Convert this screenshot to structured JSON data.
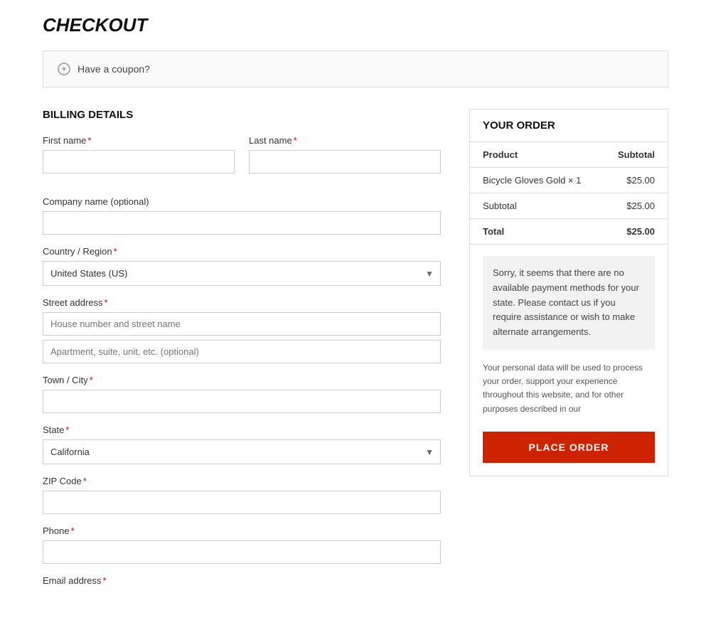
{
  "page": {
    "title": "CHECKOUT"
  },
  "coupon": {
    "text": "Have a coupon?",
    "icon": "tag"
  },
  "billing": {
    "section_title": "BILLING DETAILS",
    "fields": {
      "first_name_label": "First name",
      "last_name_label": "Last name",
      "company_label": "Company name (optional)",
      "country_label": "Country / Region",
      "country_value": "United States (US)",
      "street_label": "Street address",
      "street_placeholder": "House number and street name",
      "apt_placeholder": "Apartment, suite, unit, etc. (optional)",
      "city_label": "Town / City",
      "state_label": "State",
      "state_value": "California",
      "zip_label": "ZIP Code",
      "phone_label": "Phone",
      "email_label": "Email address"
    }
  },
  "order": {
    "section_title": "YOUR ORDER",
    "col_product": "Product",
    "col_subtotal": "Subtotal",
    "items": [
      {
        "name": "Bicycle Gloves Gold",
        "qty": "× 1",
        "price": "$25.00"
      }
    ],
    "subtotal_label": "Subtotal",
    "subtotal_value": "$25.00",
    "total_label": "Total",
    "total_value": "$25.00",
    "notice": "Sorry, it seems that there are no available payment methods for your state. Please contact us if you require assistance or wish to make alternate arrangements.",
    "privacy_text": "Your personal data will be used to process your order, support your experience throughout this website, and for other purposes described in our",
    "place_order_label": "PLACE ORDER"
  }
}
